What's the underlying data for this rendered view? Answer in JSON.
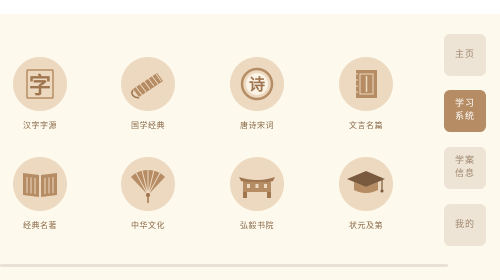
{
  "grid": [
    {
      "label": "汉字字源",
      "icon": "character-zi-icon",
      "glyph": "字"
    },
    {
      "label": "国学经典",
      "icon": "bamboo-scroll-icon"
    },
    {
      "label": "唐诗宋词",
      "icon": "poem-seal-icon",
      "glyph": "诗"
    },
    {
      "label": "文言名篇",
      "icon": "classical-book-icon"
    },
    {
      "label": "经典名著",
      "icon": "open-book-icon"
    },
    {
      "label": "中华文化",
      "icon": "folding-fan-icon"
    },
    {
      "label": "弘毅书院",
      "icon": "academy-gate-icon"
    },
    {
      "label": "状元及第",
      "icon": "graduation-cap-icon"
    }
  ],
  "sidebar": {
    "items": [
      {
        "label": "主页",
        "active": false
      },
      {
        "label": "学习\n系统",
        "active": true
      },
      {
        "label": "学案\n信息",
        "active": false
      },
      {
        "label": "我的",
        "active": false
      }
    ]
  },
  "colors": {
    "background": "#FDF9EC",
    "circle": "#EDD9C0",
    "icon": "#B58C63",
    "active": "#B58C63",
    "inactive": "#EDE4D6"
  }
}
